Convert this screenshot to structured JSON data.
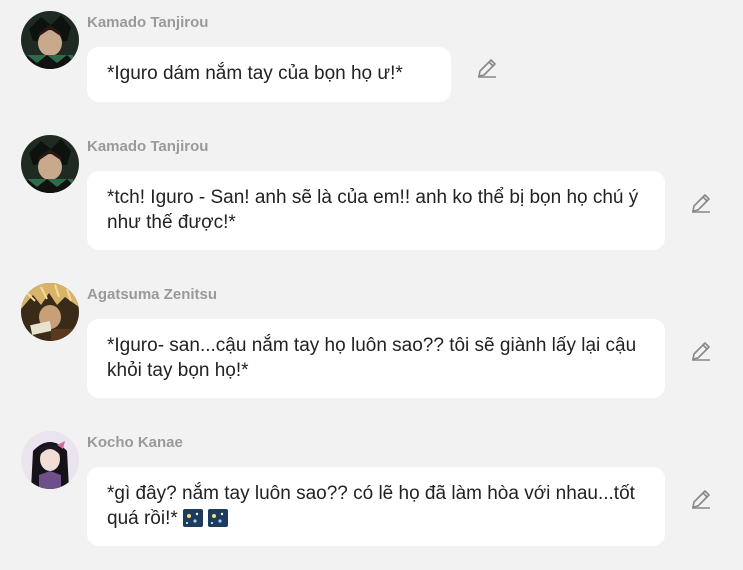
{
  "messages": [
    {
      "author": "Kamado Tanjirou",
      "text": "*Iguro dám nắm tay của bọn họ ư!*",
      "avatar_icon": "tanjirou-avatar",
      "edit_icon": "pencil-icon"
    },
    {
      "author": "Kamado Tanjirou",
      "text": "*tch! Iguro - San! anh sẽ là của em!! anh ko thể bị bọn họ chú ý như thế được!*",
      "avatar_icon": "tanjirou-avatar",
      "edit_icon": "pencil-icon"
    },
    {
      "author": "Agatsuma Zenitsu",
      "text": "*Iguro- san...cậu nắm tay họ luôn sao?? tôi sẽ giành lấy lại cậu khỏi tay bọn họ!*",
      "avatar_icon": "zenitsu-avatar",
      "edit_icon": "pencil-icon"
    },
    {
      "author": "Kocho Kanae",
      "text": "*gì đây? nắm tay luôn sao?? có lẽ họ đã làm hòa với nhau...tốt quá rồi!*",
      "emojis": [
        "night-sky-emoji",
        "night-sky-emoji"
      ],
      "avatar_icon": "kanae-avatar",
      "edit_icon": "pencil-icon"
    }
  ],
  "colors": {
    "background": "#f2f2f2",
    "bubble": "#ffffff",
    "author_name": "#9a9a9a",
    "message_text": "#222222",
    "edit_icon": "#888888"
  }
}
